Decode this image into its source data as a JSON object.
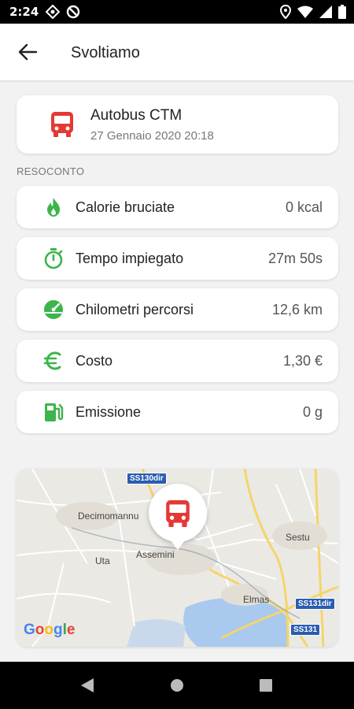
{
  "status_bar": {
    "time": "2:24"
  },
  "app_bar": {
    "title": "Svoltiamo"
  },
  "trip": {
    "line": "Autobus CTM",
    "datetime": "27 Gennaio 2020 20:18"
  },
  "section": {
    "summary_label": "RESOCONTO"
  },
  "stats": [
    {
      "label": "Calorie bruciate",
      "value": "0 kcal",
      "icon": "flame-icon"
    },
    {
      "label": "Tempo impiegato",
      "value": "27m 50s",
      "icon": "stopwatch-icon"
    },
    {
      "label": "Chilometri percorsi",
      "value": "12,6 km",
      "icon": "gauge-icon"
    },
    {
      "label": "Costo",
      "value": "1,30 €",
      "icon": "euro-icon"
    },
    {
      "label": "Emissione",
      "value": "0 g",
      "icon": "fuel-pump-icon"
    }
  ],
  "map": {
    "places": [
      "Decimomannu",
      "Uta",
      "Assemini",
      "Sestu",
      "Elmas"
    ],
    "road_shields": [
      "SS130dir",
      "SS131dir",
      "SS131"
    ],
    "attribution": "Google"
  },
  "colors": {
    "accent_green": "#3cb54a",
    "bus_red": "#e53935"
  }
}
